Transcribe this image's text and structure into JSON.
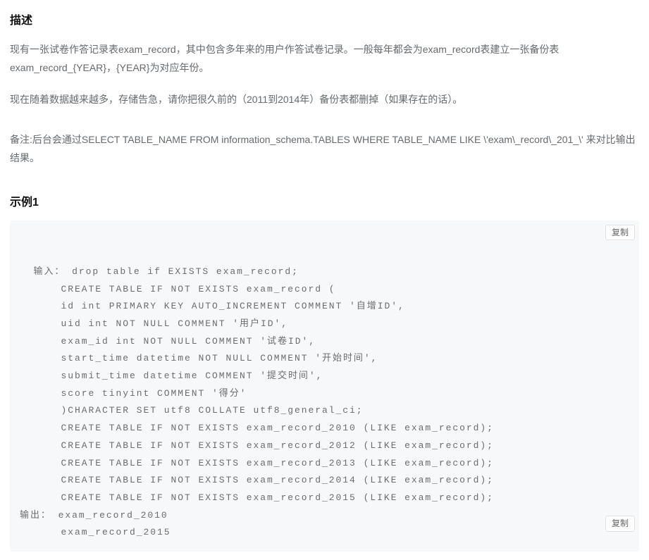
{
  "headings": {
    "description": "描述",
    "example1": "示例1"
  },
  "description": {
    "para1": "现有一张试卷作答记录表exam_record，其中包含多年来的用户作答试卷记录。一般每年都会为exam_record表建立一张备份表exam_record_{YEAR}，{YEAR}为对应年份。",
    "para2": "现在随着数据越来越多，存储告急，请你把很久前的（2011到2014年）备份表都删掉（如果存在的话）。",
    "note": "备注:后台会通过SELECT TABLE_NAME FROM information_schema.TABLES WHERE TABLE_NAME LIKE \\'exam\\_record\\_201_\\'  来对比输出结果。"
  },
  "example": {
    "copy_label": "复制",
    "input_label": "输入：",
    "output_label": "输出：",
    "input_code": "drop table if EXISTS exam_record;\nCREATE TABLE IF NOT EXISTS exam_record (\nid int PRIMARY KEY AUTO_INCREMENT COMMENT '自增ID',\nuid int NOT NULL COMMENT '用户ID',\nexam_id int NOT NULL COMMENT '试卷ID',\nstart_time datetime NOT NULL COMMENT '开始时间',\nsubmit_time datetime COMMENT '提交时间',\nscore tinyint COMMENT '得分'\n)CHARACTER SET utf8 COLLATE utf8_general_ci;\nCREATE TABLE IF NOT EXISTS exam_record_2010 (LIKE exam_record);\nCREATE TABLE IF NOT EXISTS exam_record_2012 (LIKE exam_record);\nCREATE TABLE IF NOT EXISTS exam_record_2013 (LIKE exam_record);\nCREATE TABLE IF NOT EXISTS exam_record_2014 (LIKE exam_record);\nCREATE TABLE IF NOT EXISTS exam_record_2015 (LIKE exam_record);",
    "output_code": "exam_record_2010\nexam_record_2015"
  }
}
